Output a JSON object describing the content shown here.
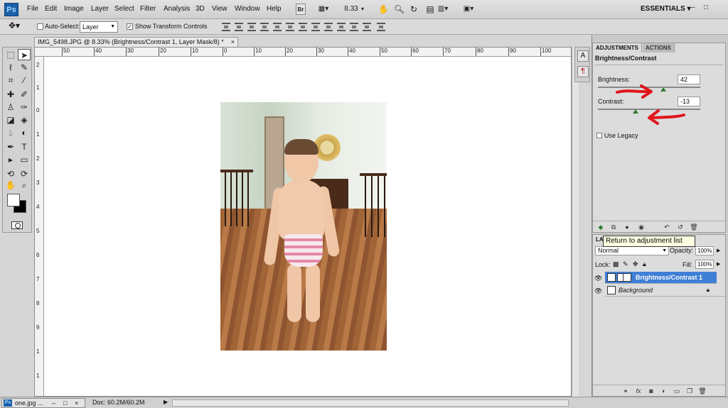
{
  "app": {
    "logo": "Ps",
    "menus": [
      "File",
      "Edit",
      "Image",
      "Layer",
      "Select",
      "Filter",
      "Analysis",
      "3D",
      "View",
      "Window",
      "Help"
    ],
    "bridge_label": "Br",
    "zoom": "8.33",
    "workspace": "ESSENTIALS",
    "window_controls": {
      "minimize": "–",
      "restore": "□"
    }
  },
  "options": {
    "auto_select_label": "Auto-Select:",
    "auto_select_checked": false,
    "target": "Layer",
    "show_transform_label": "Show Transform Controls",
    "show_transform_checked": true
  },
  "document": {
    "tab_title": "IMG_5498.JPG @ 8.33% (Brightness/Contrast 1, Layer Mask/8) *",
    "close": "×",
    "ruler_top": [
      "50",
      "40",
      "30",
      "20",
      "10",
      "0",
      "10",
      "20",
      "30",
      "40",
      "50",
      "60",
      "70",
      "80",
      "90",
      "100"
    ],
    "ruler_left": [
      "2",
      "1",
      "0",
      "1",
      "2",
      "3",
      "4",
      "5",
      "6",
      "7",
      "8",
      "9",
      "1",
      "1"
    ]
  },
  "status": {
    "taskbar_item": "one.jpg ...",
    "doc_size": "Doc: 60.2M/60.2M"
  },
  "adjustments": {
    "tabs": [
      "ADJUSTMENTS",
      "ACTIONS"
    ],
    "title": "Brightness/Contrast",
    "brightness_label": "Brightness:",
    "brightness_value": "42",
    "contrast_label": "Contrast:",
    "contrast_value": "-13",
    "legacy_label": "Use Legacy",
    "legacy_checked": false
  },
  "layers": {
    "tab": "LA",
    "blend_mode": "Normal",
    "opacity_label": "Opacity:",
    "opacity_value": "100%",
    "lock_label": "Lock:",
    "fill_label": "Fill:",
    "fill_value": "100%",
    "items": [
      {
        "name": "Brightness/Contrast 1",
        "selected": true
      },
      {
        "name": "Background",
        "selected": false
      }
    ]
  },
  "tooltip": "Return to adjustment list",
  "colors": {
    "annotation_arrow": "#e0151b",
    "selected_layer": "#3f7fd6"
  }
}
